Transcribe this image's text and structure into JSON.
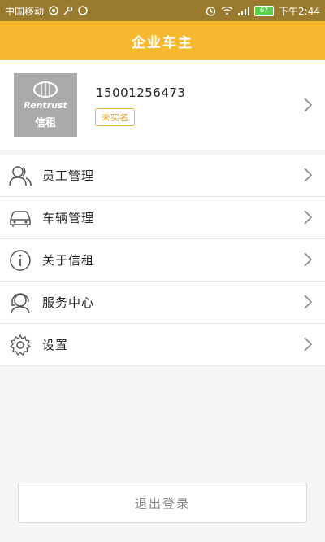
{
  "status_bar": {
    "carrier": "中国移动",
    "battery": "67",
    "time": "下午2:44"
  },
  "header": {
    "title": "企业车主"
  },
  "profile": {
    "avatar_brand": "Rentrust",
    "avatar_cn": "信租",
    "phone": "15001256473",
    "badge": "未实名"
  },
  "menu": {
    "items": [
      {
        "label": "员工管理",
        "icon": "people-icon"
      },
      {
        "label": "车辆管理",
        "icon": "car-icon"
      },
      {
        "label": "关于信租",
        "icon": "info-icon"
      },
      {
        "label": "服务中心",
        "icon": "headset-icon"
      },
      {
        "label": "设置",
        "icon": "gear-icon"
      }
    ]
  },
  "logout": {
    "label": "退出登录"
  },
  "colors": {
    "brand": "#f6b82f",
    "badge": "#f0b43a"
  }
}
